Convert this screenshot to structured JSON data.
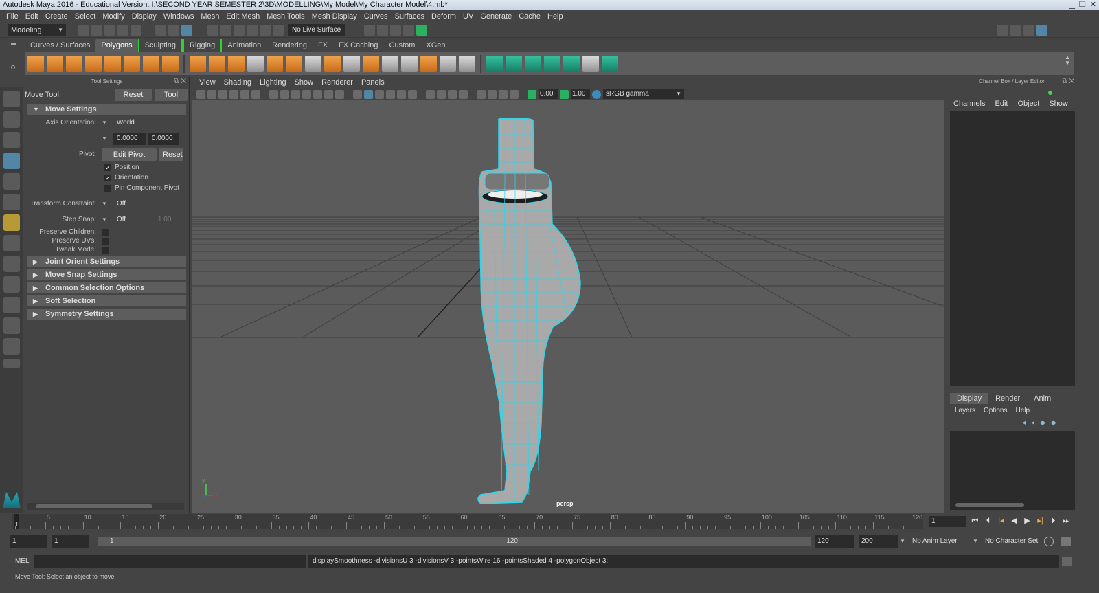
{
  "window": {
    "title": "Autodesk Maya 2016 - Educational Version: I:\\SECOND YEAR SEMESTER 2\\3D\\MODELLING\\My Model\\My Character Model\\4.mb*",
    "minimize": "▁",
    "maximize": "❐",
    "close": "✕"
  },
  "menubar": [
    "File",
    "Edit",
    "Create",
    "Select",
    "Modify",
    "Display",
    "Windows",
    "Mesh",
    "Edit Mesh",
    "Mesh Tools",
    "Mesh Display",
    "Curves",
    "Surfaces",
    "Deform",
    "UV",
    "Generate",
    "Cache",
    "Help"
  ],
  "statusline": {
    "mode": "Modeling",
    "live_surface": "No Live Surface"
  },
  "shelf": {
    "tabs": [
      "Curves / Surfaces",
      "Polygons",
      "Sculpting",
      "Rigging",
      "Animation",
      "Rendering",
      "FX",
      "FX Caching",
      "Custom",
      "XGen"
    ],
    "active_tab": "Polygons"
  },
  "tool_settings": {
    "header": "Tool Settings",
    "tool_name": "Move Tool",
    "reset_tool": "Reset Tool",
    "tool_help": "Tool Help",
    "move_settings": "Move Settings",
    "axis_orientation_label": "Axis Orientation:",
    "axis_orientation_value": "World",
    "coord1": "0.0000",
    "coord2": "0.0000",
    "pivot_label": "Pivot:",
    "edit_pivot": "Edit Pivot",
    "reset": "Reset",
    "position": "Position",
    "orientation": "Orientation",
    "pin_component_pivot": "Pin Component Pivot",
    "transform_constraint_label": "Transform Constraint:",
    "transform_constraint_value": "Off",
    "step_snap_label": "Step Snap:",
    "step_snap_value": "Off",
    "step_snap_num": "1.00",
    "preserve_children": "Preserve Children:",
    "preserve_uvs": "Preserve UVs:",
    "tweak_mode": "Tweak Mode:",
    "collapsed_sections": [
      "Joint Orient Settings",
      "Move Snap Settings",
      "Common Selection Options",
      "Soft Selection",
      "Symmetry Settings"
    ]
  },
  "viewport": {
    "menu": [
      "View",
      "Shading",
      "Lighting",
      "Show",
      "Renderer",
      "Panels"
    ],
    "exposure": "0.00",
    "gamma_value": "1.00",
    "color_space": "sRGB gamma",
    "camera": "persp",
    "axis_x": "x",
    "axis_y": "y"
  },
  "channel_box": {
    "header": "Channel Box / Layer Editor",
    "menu": [
      "Channels",
      "Edit",
      "Object",
      "Show"
    ],
    "layer_tabs": [
      "Display",
      "Render",
      "Anim"
    ],
    "active_layer_tab": "Display",
    "layer_menu": [
      "Layers",
      "Options",
      "Help"
    ]
  },
  "timeline": {
    "ticks": [
      "5",
      "10",
      "15",
      "20",
      "25",
      "30",
      "35",
      "40",
      "45",
      "50",
      "55",
      "60",
      "65",
      "70",
      "75",
      "80",
      "85",
      "90",
      "95",
      "100",
      "105",
      "110",
      "115",
      "120"
    ],
    "start": "1",
    "current_frame": "1"
  },
  "range": {
    "start": "1",
    "playback_start": "1",
    "slider_start": "1",
    "slider_end": "120",
    "playback_end": "120",
    "end": "200",
    "anim_layer": "No Anim Layer",
    "character_set": "No Character Set"
  },
  "command": {
    "mel_label": "MEL",
    "output": "displaySmoothness -divisionsU 3 -divisionsV 3 -pointsWire 16 -pointsShaded 4 -polygonObject 3;"
  },
  "help_line": "Move Tool: Select an object to move."
}
